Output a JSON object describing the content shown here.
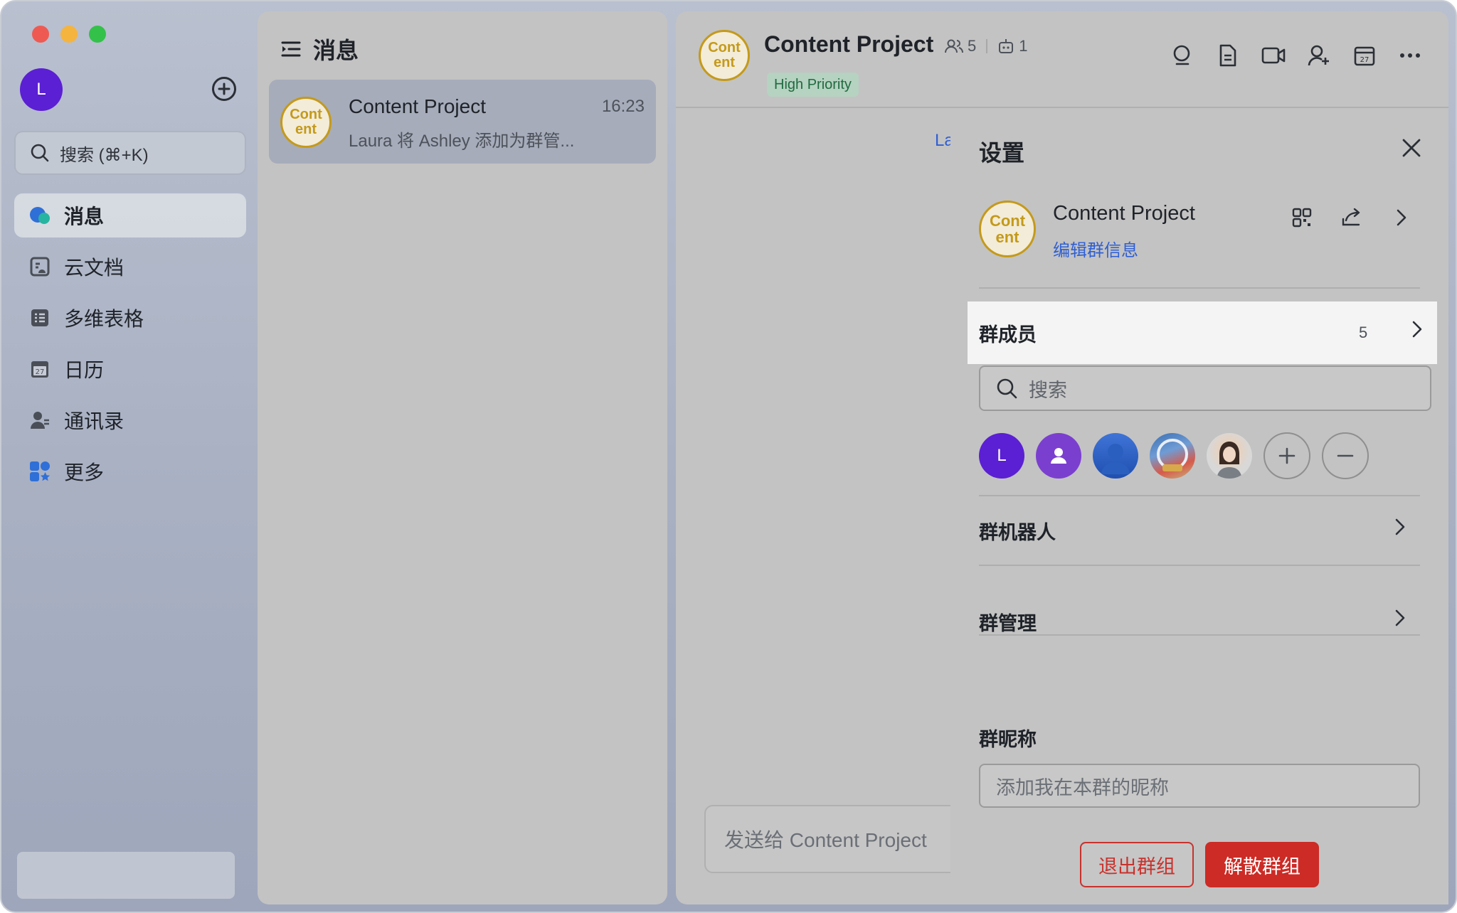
{
  "sidebar": {
    "user_initial": "L",
    "search_placeholder": "搜索 (⌘+K)",
    "nav": [
      {
        "label": "消息",
        "icon": "chat-bubble-icon",
        "active": true
      },
      {
        "label": "云文档",
        "icon": "cloud-doc-icon",
        "active": false
      },
      {
        "label": "多维表格",
        "icon": "base-table-icon",
        "active": false
      },
      {
        "label": "日历",
        "icon": "calendar-icon",
        "active": false
      },
      {
        "label": "通讯录",
        "icon": "contacts-icon",
        "active": false
      },
      {
        "label": "更多",
        "icon": "more-apps-icon",
        "active": false
      }
    ]
  },
  "list": {
    "title": "消息",
    "conversation": {
      "avatar_text": "Cont ent",
      "name": "Content Project",
      "time": "16:23",
      "preview": "Laura 将 Ashley 添加为群管..."
    }
  },
  "chat": {
    "avatar_text": "Cont ent",
    "title": "Content Project",
    "member_count": "5",
    "bot_count": "1",
    "tag": "High Priority",
    "system_line": "La",
    "composer_placeholder": "发送给 Content Project",
    "tools": [
      "search-icon",
      "doc-icon",
      "video-call-icon",
      "add-member-icon",
      "calendar-icon",
      "more-icon"
    ]
  },
  "settings": {
    "title": "设置",
    "group_name": "Content Project",
    "edit_link": "编辑群信息",
    "members_label": "群成员",
    "members_count": "5",
    "member_search_placeholder": "搜索",
    "first_member_initial": "L",
    "bots_label": "群机器人",
    "manage_label": "群管理",
    "nickname_label": "群昵称",
    "nickname_placeholder": "添加我在本群的昵称",
    "leave_button": "退出群组",
    "disband_button": "解散群组",
    "colors": {
      "accent": "#2f5fd3",
      "danger": "#cc2b26",
      "brand_gold": "#c49a1b",
      "tag_green": "#1f6b3f"
    }
  }
}
